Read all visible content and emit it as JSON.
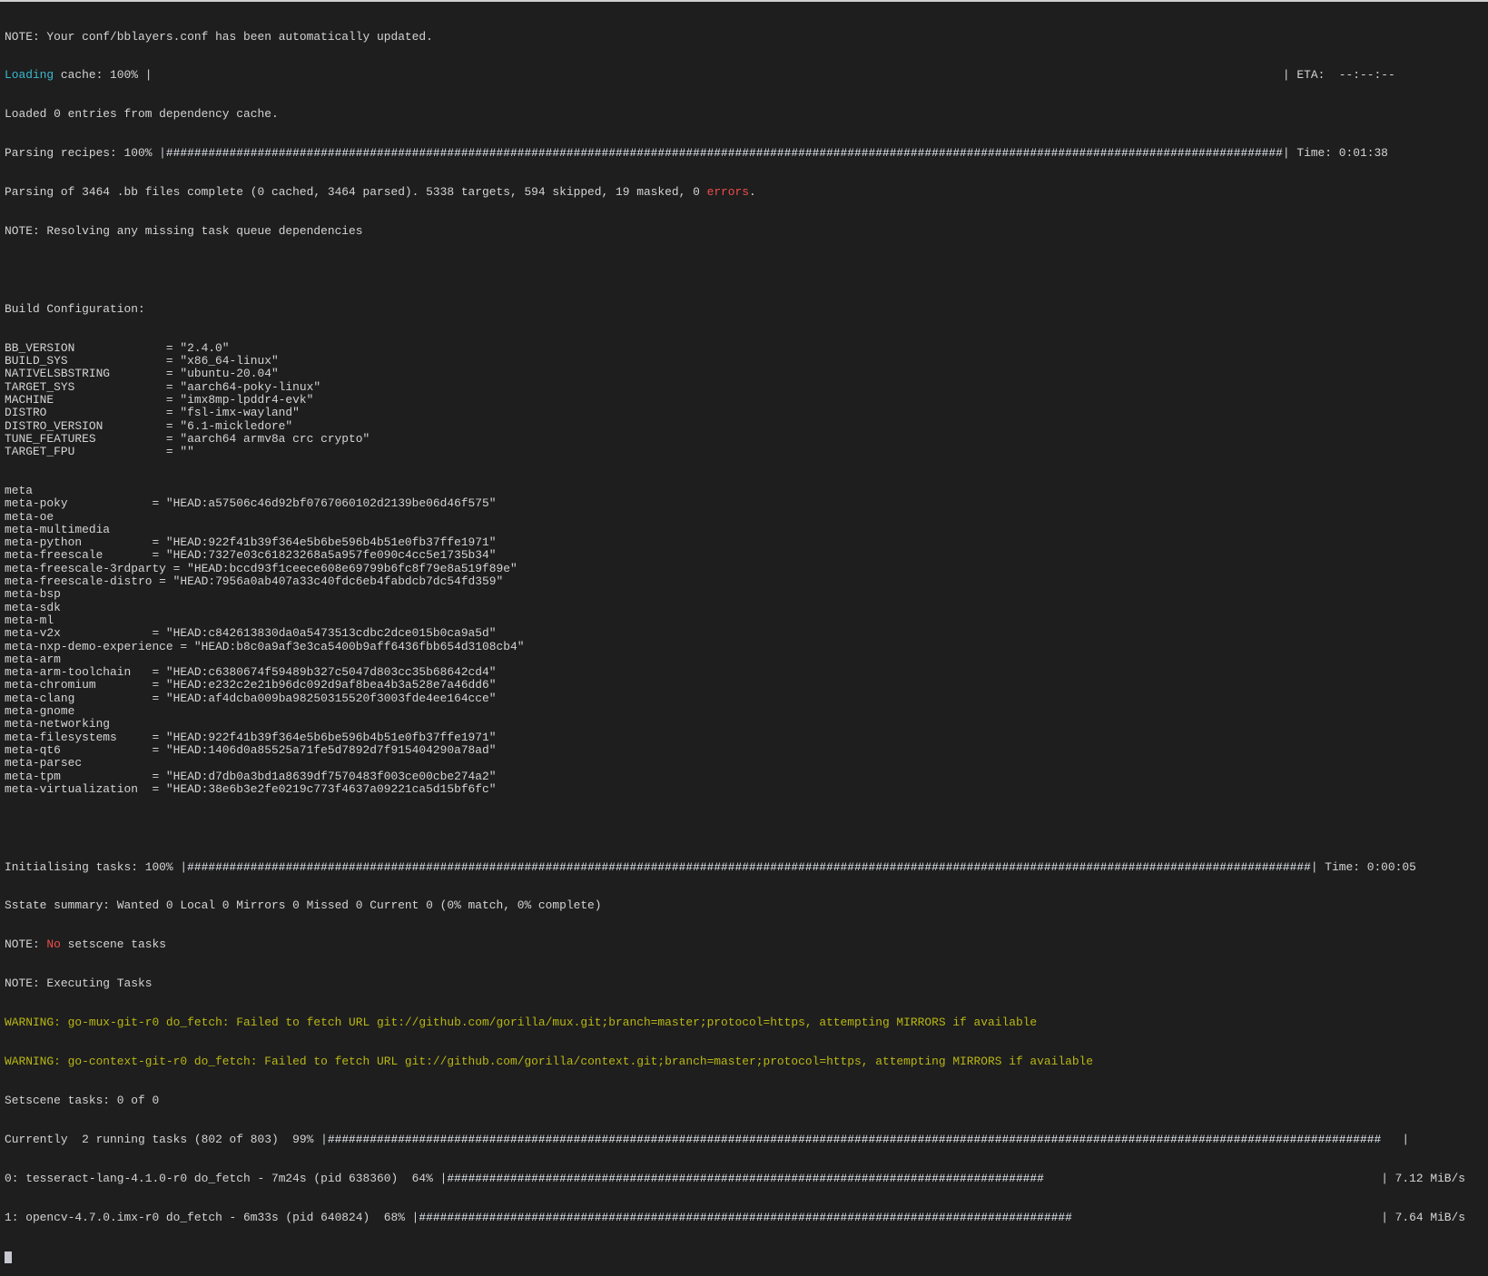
{
  "terminal": {
    "note_updated": "NOTE: Your conf/bblayers.conf has been automatically updated.",
    "loading_cache": {
      "label": "Loading",
      "rest": " cache: 100% |",
      "percent": 0,
      "eta": "| ETA:  --:--:--"
    },
    "loaded_entries": "Loaded 0 entries from dependency cache.",
    "parsing_recipes": {
      "prefix": "Parsing recipes: 100% |",
      "percent": 100,
      "suffix": "| Time: 0:01:38"
    },
    "parsing_complete": {
      "text": "Parsing of 3464 .bb files complete (0 cached, 3464 parsed). 5338 targets, 594 skipped, 19 masked, 0 ",
      "errors": "errors",
      "end": "."
    },
    "note_resolving": "NOTE: Resolving any missing task queue dependencies",
    "build_config_title": "Build Configuration:",
    "build_config": [
      {
        "key": "BB_VERSION",
        "value": "= \"2.4.0\""
      },
      {
        "key": "BUILD_SYS",
        "value": "= \"x86_64-linux\""
      },
      {
        "key": "NATIVELSBSTRING",
        "value": "= \"ubuntu-20.04\""
      },
      {
        "key": "TARGET_SYS",
        "value": "= \"aarch64-poky-linux\""
      },
      {
        "key": "MACHINE",
        "value": "= \"imx8mp-lpddr4-evk\""
      },
      {
        "key": "DISTRO",
        "value": "= \"fsl-imx-wayland\""
      },
      {
        "key": "DISTRO_VERSION",
        "value": "= \"6.1-mickledore\""
      },
      {
        "key": "TUNE_FEATURES",
        "value": "= \"aarch64 armv8a crc crypto\""
      },
      {
        "key": "TARGET_FPU",
        "value": "= \"\""
      }
    ],
    "layers": [
      "meta",
      "meta-poky            = \"HEAD:a57506c46d92bf0767060102d2139be06d46f575\"",
      "meta-oe",
      "meta-multimedia",
      "meta-python          = \"HEAD:922f41b39f364e5b6be596b4b51e0fb37ffe1971\"",
      "meta-freescale       = \"HEAD:7327e03c61823268a5a957fe090c4cc5e1735b34\"",
      "meta-freescale-3rdparty = \"HEAD:bccd93f1ceece608e69799b6fc8f79e8a519f89e\"",
      "meta-freescale-distro = \"HEAD:7956a0ab407a33c40fdc6eb4fabdcb7dc54fd359\"",
      "meta-bsp",
      "meta-sdk",
      "meta-ml",
      "meta-v2x             = \"HEAD:c842613830da0a5473513cdbc2dce015b0ca9a5d\"",
      "meta-nxp-demo-experience = \"HEAD:b8c0a9af3e3ca5400b9aff6436fbb654d3108cb4\"",
      "meta-arm",
      "meta-arm-toolchain   = \"HEAD:c6380674f59489b327c5047d803cc35b68642cd4\"",
      "meta-chromium        = \"HEAD:e232c2e21b96dc092d9af8bea4b3a528e7a46dd6\"",
      "meta-clang           = \"HEAD:af4dcba009ba98250315520f3003fde4ee164cce\"",
      "meta-gnome",
      "meta-networking",
      "meta-filesystems     = \"HEAD:922f41b39f364e5b6be596b4b51e0fb37ffe1971\"",
      "meta-qt6             = \"HEAD:1406d0a85525a71fe5d7892d7f915404290a78ad\"",
      "meta-parsec",
      "meta-tpm             = \"HEAD:d7db0a3bd1a8639df7570483f003ce00cbe274a2\"",
      "meta-virtualization  = \"HEAD:38e6b3e2fe0219c773f4637a09221ca5d15bf6fc\""
    ],
    "init_tasks": {
      "prefix": "Initialising tasks: 100% |",
      "percent": 100,
      "suffix": "| Time: 0:00:05"
    },
    "sstate_summary": "Sstate summary: Wanted 0 Local 0 Mirrors 0 Missed 0 Current 0 (0% match, 0% complete)",
    "note_no_setscene": {
      "prefix": "NOTE: ",
      "no": "No",
      "rest": " setscene tasks"
    },
    "note_executing": "NOTE: Executing Tasks",
    "warnings": [
      {
        "label": "WARNING:",
        "text": " go-mux-git-r0 do_fetch: Failed to fetch URL git://github.com/gorilla/mux.git;branch=master;protocol=https, attempting MIRRORS if available"
      },
      {
        "label": "WARNING:",
        "text": " go-context-git-r0 do_fetch: Failed to fetch URL git://github.com/gorilla/context.git;branch=master;protocol=https, attempting MIRRORS if available"
      }
    ],
    "setscene_tasks": "Setscene tasks: 0 of 0",
    "currently": {
      "prefix": "Currently  2 running tasks (802 of 803)  99% |",
      "percent": 99,
      "suffix": " |"
    },
    "running_tasks": [
      {
        "prefix": "0: tesseract-lang-4.1.0-r0 do_fetch - 7m24s (pid 638360)  64% |",
        "percent": 64,
        "speed": "| 7.12 MiB/s"
      },
      {
        "prefix": "1: opencv-4.7.0.imx-r0 do_fetch - 6m33s (pid 640824)  68% |",
        "percent": 68,
        "speed": "| 7.64 MiB/s"
      }
    ],
    "colors": {
      "background": "#1e1e1e",
      "text": "#d4d4d4",
      "info": "#3ab7cf",
      "error": "#f14c4c",
      "warning": "#b9b714"
    }
  }
}
